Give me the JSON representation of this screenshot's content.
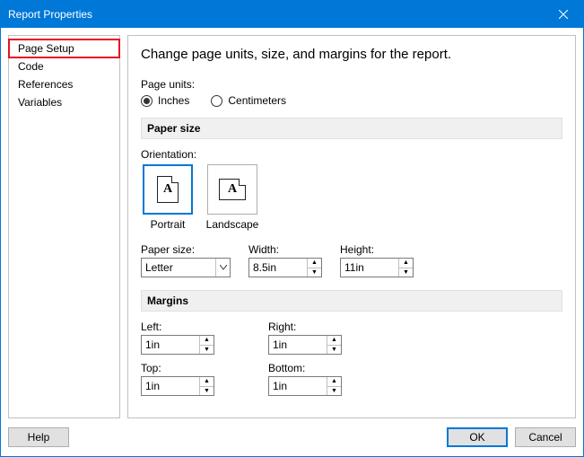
{
  "window": {
    "title": "Report Properties"
  },
  "sidebar": {
    "items": [
      {
        "label": "Page Setup"
      },
      {
        "label": "Code"
      },
      {
        "label": "References"
      },
      {
        "label": "Variables"
      }
    ]
  },
  "content": {
    "heading": "Change page units, size, and margins for the report.",
    "page_units": {
      "label": "Page units:",
      "options": {
        "inches": "Inches",
        "centimeters": "Centimeters"
      },
      "selected": "inches"
    },
    "paper_size": {
      "header": "Paper size",
      "orientation_label": "Orientation:",
      "portrait_label": "Portrait",
      "landscape_label": "Landscape",
      "icon_letter": "A",
      "paper_size_label": "Paper size:",
      "paper_size_value": "Letter",
      "width_label": "Width:",
      "width_value": "8.5in",
      "height_label": "Height:",
      "height_value": "11in"
    },
    "margins": {
      "header": "Margins",
      "left_label": "Left:",
      "left_value": "1in",
      "right_label": "Right:",
      "right_value": "1in",
      "top_label": "Top:",
      "top_value": "1in",
      "bottom_label": "Bottom:",
      "bottom_value": "1in"
    }
  },
  "footer": {
    "help": "Help",
    "ok": "OK",
    "cancel": "Cancel"
  }
}
